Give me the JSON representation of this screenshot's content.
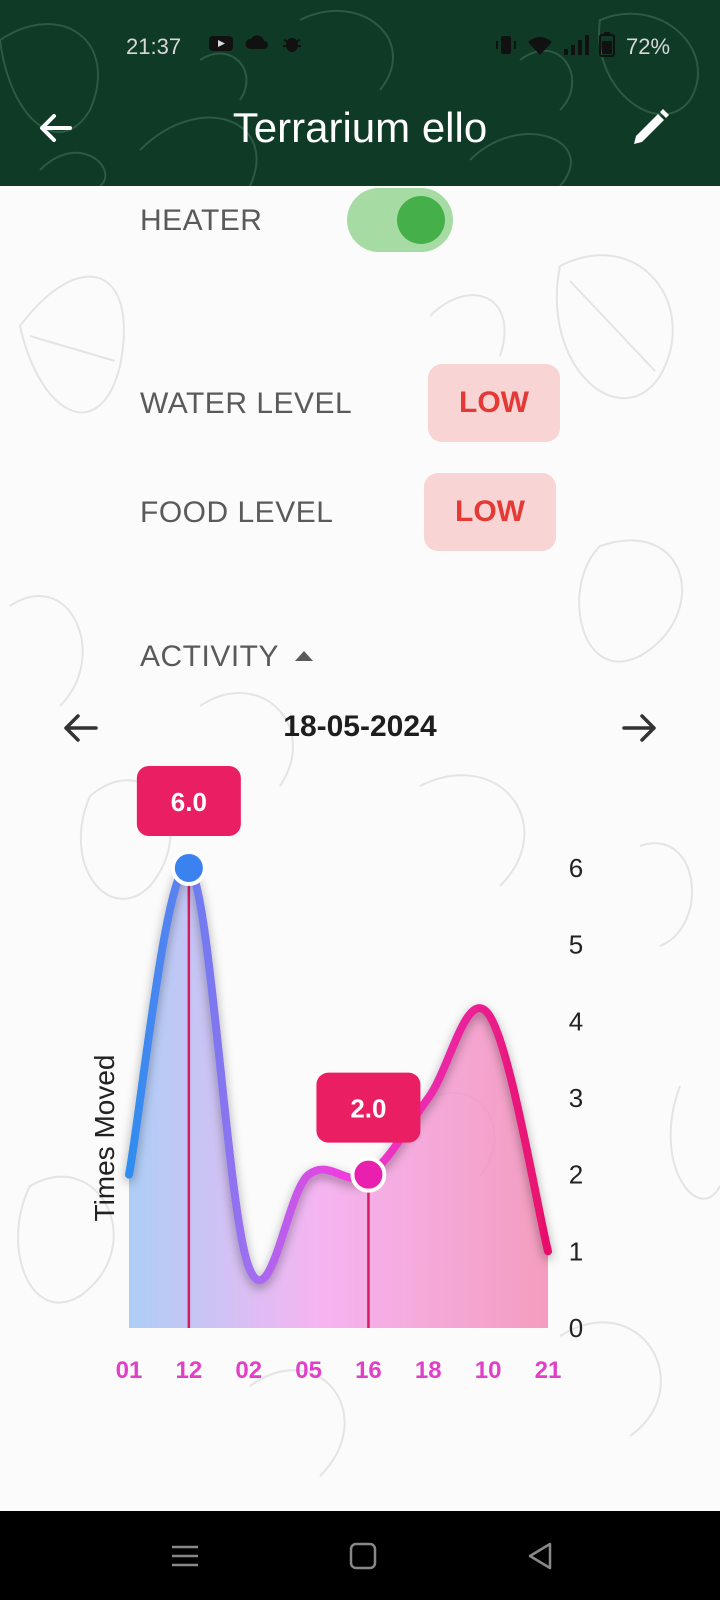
{
  "status_bar": {
    "time": "21:37",
    "battery": "72%",
    "left_icons": [
      "youtube-icon",
      "cloud-icon",
      "bug-icon"
    ],
    "right_icons": [
      "vibrate-icon",
      "wifi-icon",
      "signal-icon",
      "battery-icon"
    ]
  },
  "app_bar": {
    "title": "Terrarium ello",
    "back_icon": "arrow-back-icon",
    "edit_icon": "pencil-icon",
    "background_color": "#0f3a26"
  },
  "heater": {
    "label": "HEATER",
    "enabled": true
  },
  "water_level": {
    "label": "WATER LEVEL",
    "status": "LOW"
  },
  "food_level": {
    "label": "FOOD LEVEL",
    "status": "LOW"
  },
  "activity": {
    "label": "ACTIVITY",
    "expanded": true,
    "date": "18-05-2024"
  },
  "colors": {
    "badge_bg": "#f8d4d4",
    "badge_text": "#e53935",
    "toggle_track": "#a6dba4",
    "toggle_knob": "#45b04a",
    "tooltip_bg": "#e91e63",
    "tick_x": "#e040c8"
  },
  "chart_data": {
    "type": "line",
    "ylabel": "Times Moved",
    "xlabel": "",
    "categories": [
      "01",
      "12",
      "02",
      "05",
      "16",
      "18",
      "10",
      "21"
    ],
    "series": [
      {
        "values": [
          2.0,
          6.0,
          0.8,
          2.0,
          2.0,
          3.0,
          4.1,
          1.0
        ]
      }
    ],
    "ylim": [
      0,
      6
    ],
    "yticks": [
      "0",
      "1",
      "2",
      "3",
      "4",
      "5",
      "6"
    ],
    "y_axis_side": "right",
    "highlighted_points": [
      {
        "category": "12",
        "value": 6.0,
        "label": "6.0"
      },
      {
        "category": "16",
        "value": 2.0,
        "label": "2.0"
      }
    ],
    "area_fill": true,
    "grid": false
  },
  "system_nav": {
    "buttons": [
      "menu-icon",
      "home-icon",
      "back-triangle-icon"
    ]
  }
}
